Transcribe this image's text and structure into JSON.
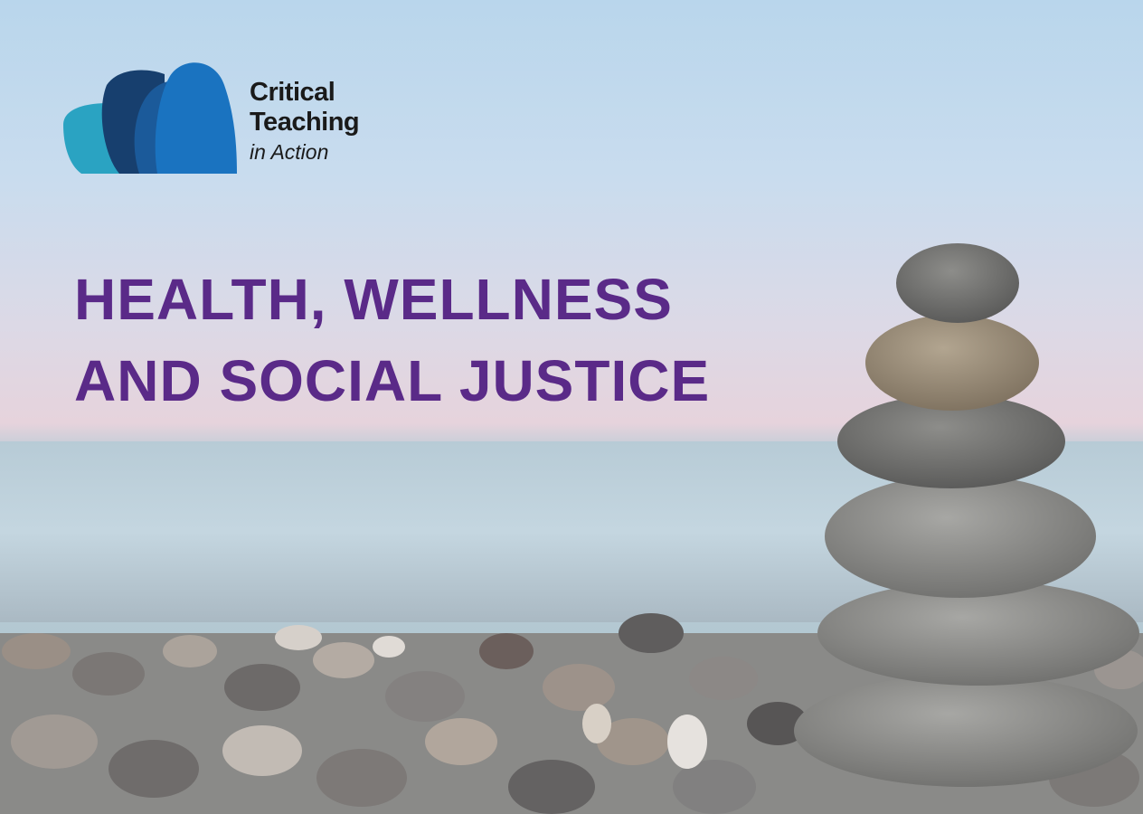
{
  "brand": {
    "line1": "Critical",
    "line2": "Teaching",
    "line3": "in Action",
    "colors": {
      "petal_light": "#2aa3c2",
      "petal_mid": "#1b5a9a",
      "petal_dark": "#173f6e",
      "petal_bright": "#1a73c0"
    }
  },
  "headline": {
    "line1": "HEALTH, WELLNESS",
    "line2": "AND SOCIAL JUSTICE",
    "color": "#5a2a88"
  }
}
